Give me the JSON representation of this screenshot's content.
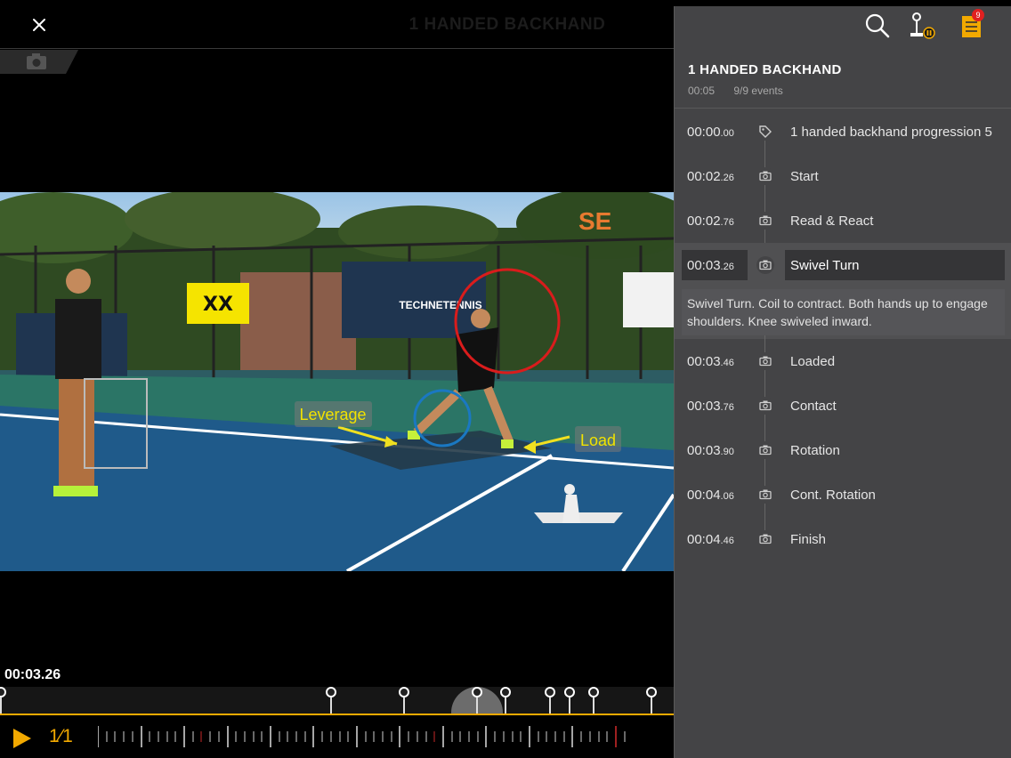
{
  "header": {
    "center_title": "1 HANDED BACKHAND"
  },
  "video": {
    "annotations": {
      "leverage": "Leverage",
      "load": "Load"
    },
    "court_signs": {
      "techne": "TECHNETENNIS",
      "corner_logo": "SE"
    }
  },
  "player": {
    "current_time": "00:03.26",
    "speed": "1⁄1"
  },
  "panel": {
    "title": "1 HANDED BACKHAND",
    "duration": "00:05",
    "events_count": "9/9 events",
    "badge_count": "9",
    "selected_note": "Swivel Turn. Coil to contract. Both hands up to engage shoulders. Knee swiveled inward.",
    "events": [
      {
        "time_main": "00:00",
        "time_frac": ".00",
        "label": "1 handed backhand progression 5",
        "icon": "tag-icon"
      },
      {
        "time_main": "00:02",
        "time_frac": ".26",
        "label": "Start",
        "icon": "camera-icon"
      },
      {
        "time_main": "00:02",
        "time_frac": ".76",
        "label": "Read & React",
        "icon": "camera-icon"
      },
      {
        "time_main": "00:03",
        "time_frac": ".26",
        "label": "Swivel Turn",
        "icon": "camera-icon"
      },
      {
        "time_main": "00:03",
        "time_frac": ".46",
        "label": "Loaded",
        "icon": "camera-icon"
      },
      {
        "time_main": "00:03",
        "time_frac": ".76",
        "label": "Contact",
        "icon": "camera-icon"
      },
      {
        "time_main": "00:03",
        "time_frac": ".90",
        "label": "Rotation",
        "icon": "camera-icon"
      },
      {
        "time_main": "00:04",
        "time_frac": ".06",
        "label": "Cont. Rotation",
        "icon": "camera-icon"
      },
      {
        "time_main": "00:04",
        "time_frac": ".46",
        "label": "Finish",
        "icon": "camera-icon"
      }
    ]
  },
  "colors": {
    "accent": "#f2a900",
    "panel_bg": "#444446",
    "badge": "#e02020"
  }
}
